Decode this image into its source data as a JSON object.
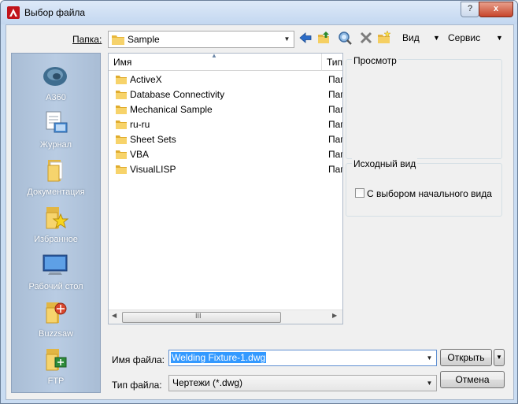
{
  "window": {
    "title": "Выбор файла",
    "controls": {
      "minimize": "",
      "close": "x"
    }
  },
  "toolbar": {
    "folder_label": "Папка:",
    "current_folder": "Sample",
    "view_label": "Вид",
    "tools_label": "Сервис"
  },
  "places": [
    {
      "label": "A360",
      "icon": "a360-icon"
    },
    {
      "label": "Журнал",
      "icon": "history-icon"
    },
    {
      "label": "Документация",
      "icon": "documents-icon"
    },
    {
      "label": "Избранное",
      "icon": "favorites-icon"
    },
    {
      "label": "Рабочий стол",
      "icon": "desktop-icon"
    },
    {
      "label": "Buzzsaw",
      "icon": "buzzsaw-icon"
    },
    {
      "label": "FTP",
      "icon": "ftp-icon"
    }
  ],
  "file_list": {
    "columns": [
      "Имя",
      "Тип"
    ],
    "rows": [
      {
        "name": "ActiveX",
        "type": "Пап"
      },
      {
        "name": "Database Connectivity",
        "type": "Пап"
      },
      {
        "name": "Mechanical Sample",
        "type": "Пап"
      },
      {
        "name": "ru-ru",
        "type": "Пап"
      },
      {
        "name": "Sheet Sets",
        "type": "Пап"
      },
      {
        "name": "VBA",
        "type": "Пап"
      },
      {
        "name": "VisualLISP",
        "type": "Пап"
      }
    ],
    "scroll_grip": "III"
  },
  "preview": {
    "title": "Просмотр"
  },
  "initial_view": {
    "title": "Исходный вид",
    "checkbox_label": "С выбором начального вида",
    "checked": false
  },
  "file_name": {
    "label": "Имя файла:",
    "value": "Welding Fixture-1.dwg"
  },
  "file_type": {
    "label": "Тип файла:",
    "value": "Чертежи (*.dwg)"
  },
  "buttons": {
    "open": "Открыть",
    "cancel": "Отмена"
  },
  "colors": {
    "accent": "#3399ff",
    "title_bar": "#c9dcf2",
    "places_bar": "#b4c7de"
  }
}
